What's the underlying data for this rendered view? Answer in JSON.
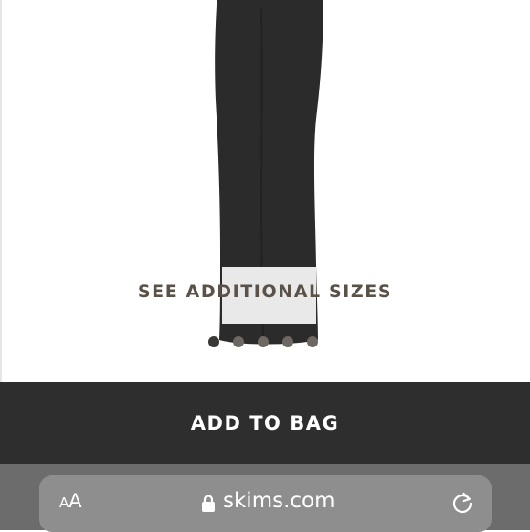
{
  "product": {
    "image_alt": "black maxi skirt",
    "skirt_color": "#2b2b2b",
    "see_sizes_label": "SEE ADDITIONAL SIZES",
    "carousel": {
      "total": 5,
      "active_index": 0
    }
  },
  "actions": {
    "add_to_bag_label": "ADD TO BAG"
  },
  "browser": {
    "text_size_small": "A",
    "text_size_large": "A",
    "url": "skims.com",
    "lock_icon": "lock-icon",
    "reload_icon": "reload-icon"
  },
  "colors": {
    "add_bar_bg": "#2e2e2e",
    "brand_text": "#5a5148",
    "browser_bg": "#6c6c6c",
    "url_field_bg": "#8e8e8e"
  }
}
